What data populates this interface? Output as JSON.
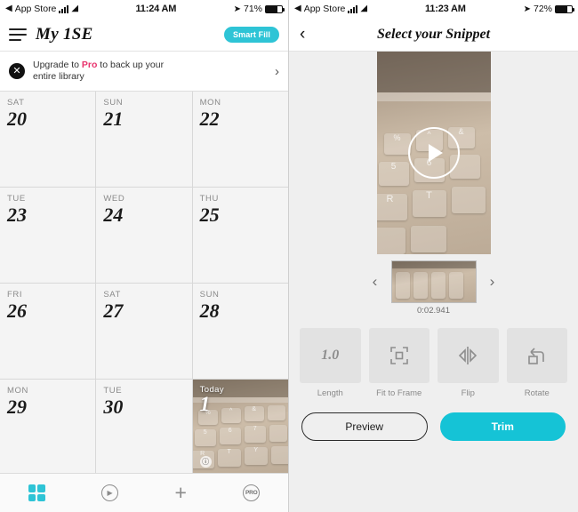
{
  "left": {
    "status": {
      "carrier_label": "App Store",
      "time": "11:24 AM",
      "battery": "71%"
    },
    "nav": {
      "title": "My 1SE",
      "smart_fill": "Smart Fill"
    },
    "banner": {
      "line1_pre": "Upgrade to ",
      "line1_bold": "Pro",
      "line1_post": " to back up your",
      "line2": "entire library",
      "chevron": "›"
    },
    "calendar": {
      "cells": [
        {
          "dow": "SAT",
          "day": "20"
        },
        {
          "dow": "SUN",
          "day": "21"
        },
        {
          "dow": "MON",
          "day": "22"
        },
        {
          "dow": "TUE",
          "day": "23"
        },
        {
          "dow": "WED",
          "day": "24"
        },
        {
          "dow": "THU",
          "day": "25"
        },
        {
          "dow": "FRI",
          "day": "26"
        },
        {
          "dow": "SAT",
          "day": "27"
        },
        {
          "dow": "SUN",
          "day": "28"
        },
        {
          "dow": "MON",
          "day": "29"
        },
        {
          "dow": "TUE",
          "day": "30"
        }
      ],
      "today_cell": {
        "dow": "Today",
        "day": "1",
        "badge": "ⓘ"
      }
    },
    "tabbar": {
      "items": [
        {
          "name": "grid",
          "label": ""
        },
        {
          "name": "play",
          "label": "▶"
        },
        {
          "name": "add",
          "label": "+"
        },
        {
          "name": "pro",
          "label": "PRO"
        }
      ]
    }
  },
  "right": {
    "status": {
      "carrier_label": "App Store",
      "time": "11:23 AM",
      "battery": "72%"
    },
    "nav": {
      "back": "‹",
      "title": "Select your Snippet"
    },
    "player": {
      "play_icon": "play-icon"
    },
    "trim": {
      "prev": "‹",
      "next": "›",
      "timecode": "0:02.941"
    },
    "tools": [
      {
        "label": "Length",
        "value": "1.0",
        "icon": "length-icon"
      },
      {
        "label": "Fit to Frame",
        "value": "",
        "icon": "fit-to-frame-icon"
      },
      {
        "label": "Flip",
        "value": "",
        "icon": "flip-icon"
      },
      {
        "label": "Rotate",
        "value": "",
        "icon": "rotate-icon"
      }
    ],
    "actions": {
      "preview": "Preview",
      "trim": "Trim"
    }
  },
  "colors": {
    "accent": "#15c3d6",
    "pro_pink": "#e8336d",
    "grid_bg": "#f4f4f4"
  }
}
